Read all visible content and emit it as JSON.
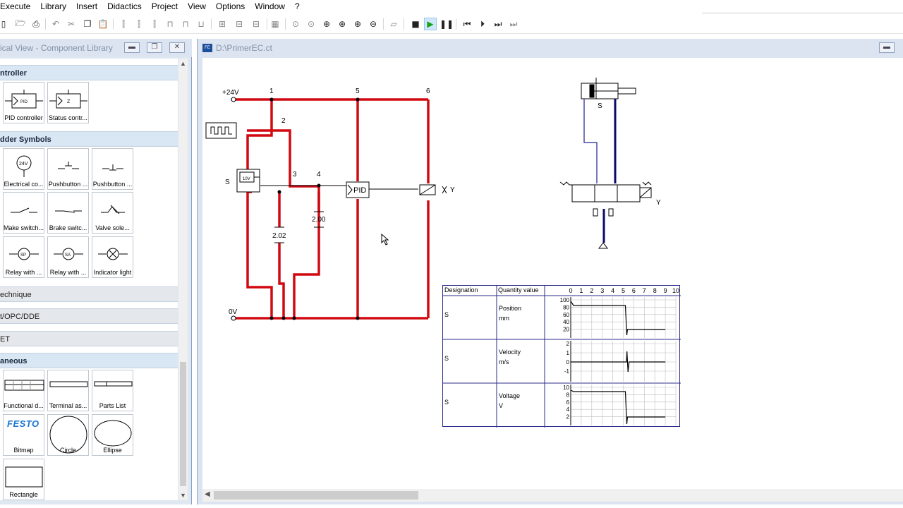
{
  "menu": {
    "items": [
      "Execute",
      "Library",
      "Insert",
      "Didactics",
      "Project",
      "View",
      "Options",
      "Window",
      "?"
    ]
  },
  "toolbar": {
    "icons": [
      "new",
      "open",
      "print",
      "undo",
      "cut",
      "copy",
      "paste",
      "align-left",
      "align-center",
      "align-right",
      "align-top",
      "align-middle",
      "align-bottom",
      "grid",
      "zoom-fit",
      "zoom-window",
      "zoom-full",
      "zoom-in",
      "zoom-out",
      "check",
      "stop",
      "play",
      "pause",
      "reset",
      "step",
      "step-forward",
      "fast-forward"
    ]
  },
  "library": {
    "title": "ical View - Component Library",
    "categories": [
      {
        "label": "ntroller",
        "state": "open",
        "items": [
          "PID controller",
          "Status contr..."
        ]
      },
      {
        "label": "dder Symbols",
        "state": "open",
        "items": [
          "Electrical co...",
          "Pushbutton ...",
          "Pushbutton ...",
          "Make switch...",
          "Brake switc...",
          "Valve sole...",
          "Relay with ...",
          "Relay with ...",
          "Indicator light"
        ]
      },
      {
        "label": "echnique",
        "state": "closed"
      },
      {
        "label": "t/OPC/DDE",
        "state": "closed"
      },
      {
        "label": "ET",
        "state": "closed"
      },
      {
        "label": "aneous",
        "state": "open",
        "items": [
          "Functional d...",
          "Terminal as...",
          "Parts List",
          "Bitmap",
          "Circle",
          "Ellipse",
          "Rectangle"
        ]
      }
    ],
    "bitmap_text": "FESTO",
    "pid_symbol": "PID",
    "status_symbol": "Z",
    "lamp_symbol": "24V",
    "relay1_symbol": "SP",
    "relay2_symbol": "SA"
  },
  "circuit": {
    "title": "D:\\PrimerEC.ct",
    "labels": {
      "v24": "+24V",
      "v0": "0V",
      "n1": "1",
      "n2": "2",
      "n3": "3",
      "n4": "4",
      "n5": "5",
      "n6": "6",
      "s1": "S",
      "s2": "S",
      "y1": "Y",
      "y2": "Y",
      "pid": "PID",
      "sensor": "10V",
      "r1": "2.02",
      "r2": "2.00"
    },
    "colors": {
      "wire_active": "#d10a12",
      "wire_pneumatic": "#0a0a6a",
      "wire_light": "#4a4aa8"
    }
  },
  "diagram": {
    "headers": {
      "designation": "Designation",
      "quantity": "Quantity value"
    },
    "x_ticks": [
      "0",
      "1",
      "2",
      "3",
      "4",
      "5",
      "6",
      "7",
      "8",
      "9",
      "10"
    ],
    "rows": [
      {
        "designation": "S",
        "quantity": "Position",
        "unit": "mm",
        "y_ticks": [
          "100",
          "80",
          "60",
          "40",
          "20"
        ]
      },
      {
        "designation": "S",
        "quantity": "Velocity",
        "unit": "m/s",
        "y_ticks": [
          "2",
          "1",
          "0",
          "-1"
        ]
      },
      {
        "designation": "S",
        "quantity": "Voltage",
        "unit": "V",
        "y_ticks": [
          "10",
          "8",
          "6",
          "4",
          "2"
        ]
      }
    ]
  }
}
